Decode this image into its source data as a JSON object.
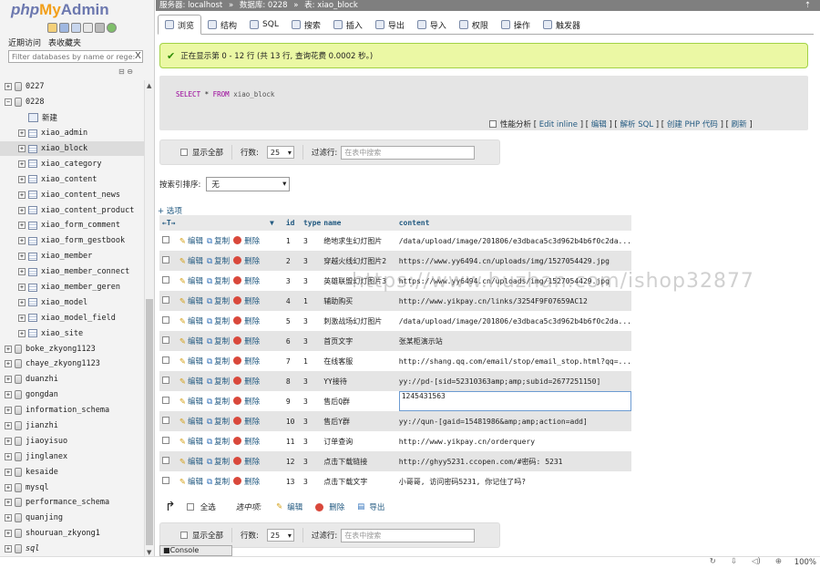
{
  "left": {
    "logo": {
      "php": "php",
      "my": "My",
      "admin": "Admin"
    },
    "nav_links": [
      "近期访问",
      "表收藏夹"
    ],
    "filter_placeholder": "Filter databases by name or rege:",
    "filter_clear": "X",
    "tree": [
      {
        "label": "0227",
        "kind": "db",
        "indent": 0,
        "expanded": false
      },
      {
        "label": "0228",
        "kind": "db",
        "indent": 0,
        "expanded": true
      },
      {
        "label": "新建",
        "kind": "new",
        "indent": 1
      },
      {
        "label": "xiao_admin",
        "kind": "table",
        "indent": 1
      },
      {
        "label": "xiao_block",
        "kind": "table",
        "indent": 1,
        "selected": true
      },
      {
        "label": "xiao_category",
        "kind": "table",
        "indent": 1
      },
      {
        "label": "xiao_content",
        "kind": "table",
        "indent": 1
      },
      {
        "label": "xiao_content_news",
        "kind": "table",
        "indent": 1
      },
      {
        "label": "xiao_content_product",
        "kind": "table",
        "indent": 1
      },
      {
        "label": "xiao_form_comment",
        "kind": "table",
        "indent": 1
      },
      {
        "label": "xiao_form_gestbook",
        "kind": "table",
        "indent": 1
      },
      {
        "label": "xiao_member",
        "kind": "table",
        "indent": 1
      },
      {
        "label": "xiao_member_connect",
        "kind": "table",
        "indent": 1
      },
      {
        "label": "xiao_member_geren",
        "kind": "table",
        "indent": 1
      },
      {
        "label": "xiao_model",
        "kind": "table",
        "indent": 1
      },
      {
        "label": "xiao_model_field",
        "kind": "table",
        "indent": 1
      },
      {
        "label": "xiao_site",
        "kind": "table",
        "indent": 1
      },
      {
        "label": "boke_zkyong1123",
        "kind": "db",
        "indent": 0
      },
      {
        "label": "chaye_zkyong1123",
        "kind": "db",
        "indent": 0
      },
      {
        "label": "duanzhi",
        "kind": "db",
        "indent": 0
      },
      {
        "label": "gongdan",
        "kind": "db",
        "indent": 0
      },
      {
        "label": "information_schema",
        "kind": "db",
        "indent": 0
      },
      {
        "label": "jianzhi",
        "kind": "db",
        "indent": 0
      },
      {
        "label": "jiaoyisuo",
        "kind": "db",
        "indent": 0
      },
      {
        "label": "jinglanex",
        "kind": "db",
        "indent": 0
      },
      {
        "label": "kesaide",
        "kind": "db",
        "indent": 0
      },
      {
        "label": "mysql",
        "kind": "db",
        "indent": 0
      },
      {
        "label": "performance_schema",
        "kind": "db",
        "indent": 0
      },
      {
        "label": "quanjing",
        "kind": "db",
        "indent": 0
      },
      {
        "label": "shouruan_zkyong1",
        "kind": "db",
        "indent": 0
      },
      {
        "label": "sql",
        "kind": "db",
        "indent": 0
      }
    ]
  },
  "breadcrumb": {
    "server": "服务器: localhost",
    "database": "数据库: 0228",
    "table": "表: xiao_block"
  },
  "tabs": [
    {
      "label": "浏览",
      "active": true
    },
    {
      "label": "结构"
    },
    {
      "label": "SQL"
    },
    {
      "label": "搜索"
    },
    {
      "label": "插入"
    },
    {
      "label": "导出"
    },
    {
      "label": "导入"
    },
    {
      "label": "权限"
    },
    {
      "label": "操作"
    },
    {
      "label": "触发器"
    }
  ],
  "success_message": "正在显示第 0 - 12 行 (共 13 行, 查询花费 0.0002 秒。)",
  "sql": {
    "select": "SELECT",
    "star": "*",
    "from": "FROM",
    "table": "xiao_block"
  },
  "sql_links": {
    "profiling": "性能分析",
    "inline": "Edit inline",
    "edit": "编辑",
    "explain": "解析 SQL",
    "php": "创建 PHP 代码",
    "refresh": "刷新"
  },
  "navbar": {
    "show_all": "显示全部",
    "rows_label": "行数:",
    "rows_value": "25",
    "filter_label": "过滤行:",
    "filter_placeholder": "在表中搜索"
  },
  "sort": {
    "label": "按索引排序:",
    "value": "无"
  },
  "options_link": "+ 选项",
  "columns": {
    "arrows": "←T→",
    "id": "id",
    "type": "type",
    "name": "name",
    "content": "content"
  },
  "actions": {
    "edit": "编辑",
    "copy": "复制",
    "delete": "删除"
  },
  "rows": [
    {
      "id": "1",
      "type": "3",
      "name": "绝地求生幻灯图片",
      "content": "/data/upload/image/201806/e3dbaca5c3d962b4b6f0c2da..."
    },
    {
      "id": "2",
      "type": "3",
      "name": "穿越火线幻灯图片2",
      "content": "https://www.yy6494.cn/uploads/img/1527054429.jpg"
    },
    {
      "id": "3",
      "type": "3",
      "name": "英雄联盟幻灯图片3",
      "content": "https://www.yy6494.cn/uploads/img/1527054429.jpg"
    },
    {
      "id": "4",
      "type": "1",
      "name": "辅助购买",
      "content": "http://www.yikpay.cn/links/3254F9F07659AC12"
    },
    {
      "id": "5",
      "type": "3",
      "name": "刺激战场幻灯图片",
      "content": "/data/upload/image/201806/e3dbaca5c3d962b4b6f0c2da..."
    },
    {
      "id": "6",
      "type": "3",
      "name": "首页文字",
      "content": "张某柜演示站"
    },
    {
      "id": "7",
      "type": "1",
      "name": "在线客服",
      "content": "http://shang.qq.com/email/stop/email_stop.html?qq=..."
    },
    {
      "id": "8",
      "type": "3",
      "name": "YY接待",
      "content": "yy://pd-[sid=52310363amp;amp;subid=2677251150]"
    },
    {
      "id": "9",
      "type": "3",
      "name": "售后Q群",
      "content": "1245431563",
      "editing": true
    },
    {
      "id": "10",
      "type": "3",
      "name": "售后Y群",
      "content": "yy://qun-[gaid=15481986&amp;amp;action=add]"
    },
    {
      "id": "11",
      "type": "3",
      "name": "订单查询",
      "content": "http://www.yikpay.cn/orderquery"
    },
    {
      "id": "12",
      "type": "3",
      "name": "点击下载链接",
      "content": "http://ghyy5231.ccopen.com/#密码: 5231"
    },
    {
      "id": "13",
      "type": "3",
      "name": "点击下载文字",
      "content": "小哥哥, 访问密码5231, 你记住了吗?"
    }
  ],
  "bottom_actions": {
    "select_all": "全选",
    "selected": "选中项:",
    "edit": "编辑",
    "delete": "删除",
    "export": "导出"
  },
  "console": "Console",
  "watermark": "https://www.huzhan.com/ishop32877",
  "zoom": "100%"
}
